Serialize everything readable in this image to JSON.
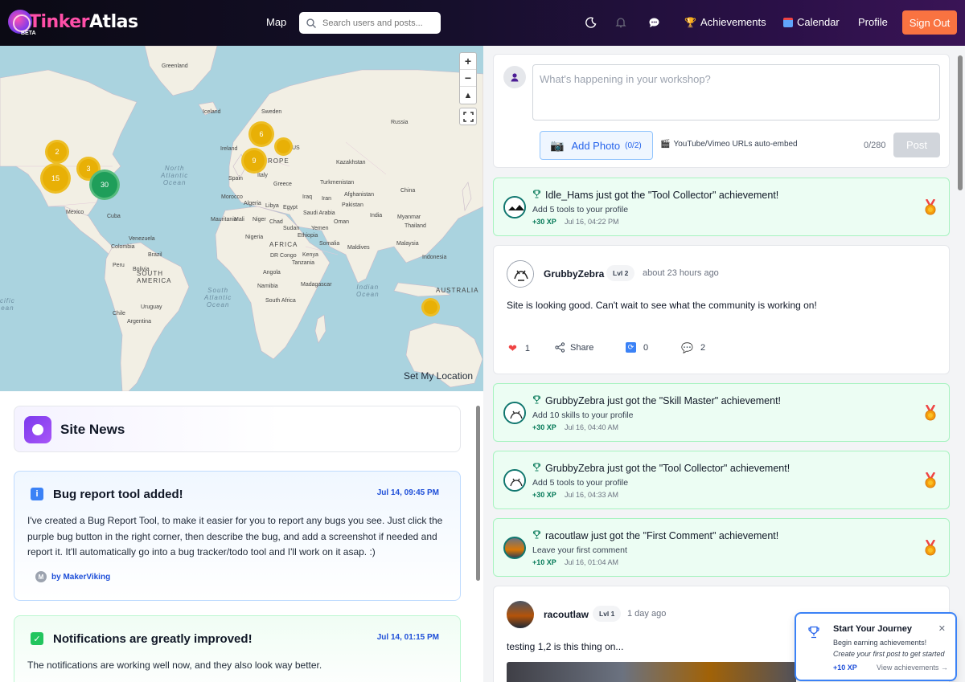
{
  "app": {
    "logo_part1": "Tinker",
    "logo_part2": "Atlas",
    "beta": "BETA"
  },
  "nav": {
    "map": "Map",
    "search_placeholder": "Search users and posts...",
    "achievements": "Achievements",
    "calendar": "Calendar",
    "profile": "Profile",
    "sign_out": "Sign Out"
  },
  "map": {
    "labels": {
      "greenland": "Greenland",
      "iceland": "Iceland",
      "sweden": "Sweden",
      "russia": "Russia",
      "ireland": "Ireland",
      "spain": "Spain",
      "italy": "Italy",
      "greece": "Greece",
      "kazakhstan": "Kazakhstan",
      "turkmenistan": "Turkmenistan",
      "china": "China",
      "afghanistan": "Afghanistan",
      "pakistan": "Pakistan",
      "iran": "Iran",
      "iraq": "Iraq",
      "morocco": "Morocco",
      "algeria": "Algeria",
      "libya": "Libya",
      "egypt": "Egypt",
      "saudi": "Saudi Arabia",
      "mauritania": "Mauritania",
      "mali": "Mali",
      "niger": "Niger",
      "chad": "Chad",
      "sudan": "Sudan",
      "yemen": "Yemen",
      "nigeria": "Nigeria",
      "ethiopia": "Ethiopia",
      "somalia": "Somalia",
      "drc": "DR Congo",
      "kenya": "Kenya",
      "tanzania": "Tanzania",
      "angola": "Angola",
      "namibia": "Namibia",
      "madagascar": "Madagascar",
      "south_africa": "South Africa",
      "india": "India",
      "myanmar": "Myanmar",
      "thailand": "Thailand",
      "malaysia": "Malaysia",
      "indonesia": "Indonesia",
      "maldives": "Maldives",
      "australia": "AUSTRALIA",
      "africa": "AFRICA",
      "europe": "ROPE",
      "us": "US",
      "mexico": "Mexico",
      "cuba": "Cuba",
      "colombia": "Colombia",
      "venezuela": "Venezuela",
      "peru": "Peru",
      "brazil": "Brazil",
      "bolivia": "Bolivia",
      "south_america": "SOUTH\nAMERICA",
      "uruguay": "Uruguay",
      "argentina": "Argentina",
      "chile": "Chile",
      "oman": "Oman"
    },
    "oceans": {
      "north_atlantic": "North\nAtlantic\nOcean",
      "south_atlantic": "South\nAtlantic\nOcean",
      "indian": "Indian\nOcean",
      "pacific": "cific\nean"
    },
    "clusters": [
      "2",
      "15",
      "3",
      "30",
      "6",
      "9",
      ""
    ],
    "set_location": "Set My Location"
  },
  "site_news": {
    "title": "Site News",
    "items": [
      {
        "badge": "i",
        "title": "Bug report tool added!",
        "date": "Jul 14, 09:45 PM",
        "body": "I've created a Bug Report Tool, to make it easier for you to report any bugs you see. Just click the purple bug button in the right corner, then describe the bug, and add a screenshot if needed and report it. It'll automatically go into a bug tracker/todo tool and I'll work on it asap. :)",
        "author_initial": "M",
        "author": "by MakerViking"
      },
      {
        "badge": "✓",
        "title": "Notifications are greatly improved!",
        "date": "Jul 14, 01:15 PM",
        "body": "The notifications are working well now, and they also look way better."
      }
    ]
  },
  "composer": {
    "placeholder": "What's happening in your workshop?",
    "add_photo": "Add Photo",
    "photo_count": "(0/2)",
    "embed_hint": "YouTube/Vimeo URLs auto-embed",
    "char_count": "0/280",
    "post": "Post"
  },
  "feed": {
    "achievements": [
      {
        "title": "Idle_Hams just got the \"Tool Collector\" achievement!",
        "desc": "Add 5 tools to your profile",
        "xp": "+30 XP",
        "time": "Jul 16, 04:22 PM"
      },
      {
        "title": "GrubbyZebra just got the \"Skill Master\" achievement!",
        "desc": "Add 10 skills to your profile",
        "xp": "+30 XP",
        "time": "Jul 16, 04:40 AM"
      },
      {
        "title": "GrubbyZebra just got the \"Tool Collector\" achievement!",
        "desc": "Add 5 tools to your profile",
        "xp": "+30 XP",
        "time": "Jul 16, 04:33 AM"
      },
      {
        "title": "racoutlaw just got the \"First Comment\" achievement!",
        "desc": "Leave your first comment",
        "xp": "+10 XP",
        "time": "Jul 16, 01:04 AM"
      }
    ],
    "post1": {
      "name": "GrubbyZebra",
      "level": "Lvl 2",
      "time": "about 23 hours ago",
      "body": "Site is looking good. Can't wait to see what the community is working on!",
      "likes": "1",
      "share": "Share",
      "reposts": "0",
      "comments": "2"
    },
    "post2": {
      "name": "racoutlaw",
      "level": "Lvl 1",
      "time": "1 day ago",
      "body": "testing 1,2 is this thing on..."
    }
  },
  "toast": {
    "title": "Start Your Journey",
    "close": "✕",
    "subtitle": "Begin earning achievements!",
    "hint": "Create your first post to get started",
    "xp": "+10 XP",
    "view": "View achievements →"
  }
}
